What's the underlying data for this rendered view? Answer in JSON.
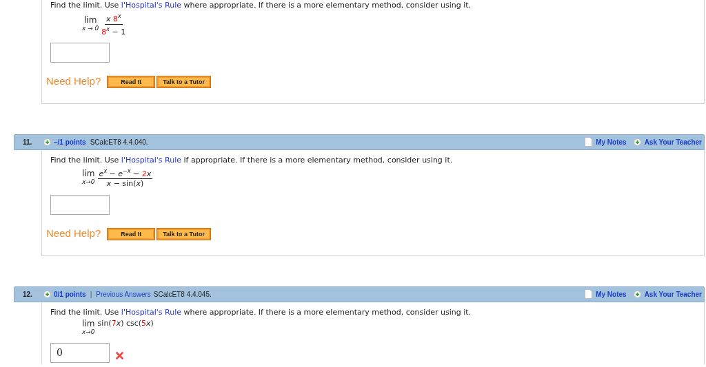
{
  "problems": [
    {
      "question": {
        "before": "Find the limit. Use ",
        "link": "l'Hospital's Rule",
        "after": " where appropriate. If there is a more elementary method, consider using it."
      },
      "expression": {
        "kind": "fraction",
        "lim": "lim",
        "under": "x → 0",
        "numerator": [
          {
            "text": "x",
            "kind": "variable",
            "raised": false,
            "highlight": false
          },
          {
            "text": " 8",
            "kind": "symbol",
            "raised": false,
            "highlight": true
          },
          {
            "text": "x",
            "kind": "variable",
            "raised": true,
            "highlight": false
          }
        ],
        "denominator": [
          {
            "text": "8",
            "kind": "symbol",
            "raised": false,
            "highlight": true
          },
          {
            "text": "x",
            "kind": "variable",
            "raised": true,
            "highlight": false
          },
          {
            "text": " − 1",
            "kind": "symbol",
            "raised": false,
            "highlight": false
          }
        ]
      },
      "answer": {
        "wrong": false
      },
      "help": {
        "label": "Need Help?",
        "buttons": [
          "Read It",
          "Talk to a Tutor"
        ]
      }
    },
    {
      "header": {
        "number": "11.",
        "points": "–/1 points",
        "source": "SCalcET8 4.4.040.",
        "notes": "My Notes",
        "ask": "Ask Your Teacher"
      },
      "question": {
        "before": "Find the limit. Use ",
        "link": "l'Hospital's Rule",
        "after": " if appropriate. If there is a more elementary method, consider using it."
      },
      "expression": {
        "kind": "fraction",
        "lim": "lim",
        "under": "x→0",
        "numerator": [
          {
            "text": "e",
            "kind": "variable",
            "raised": false,
            "highlight": false
          },
          {
            "text": "x",
            "kind": "variable",
            "raised": true,
            "highlight": false
          },
          {
            "text": " − ",
            "kind": "symbol",
            "raised": false,
            "highlight": false
          },
          {
            "text": "e",
            "kind": "variable",
            "raised": false,
            "highlight": false
          },
          {
            "text": "−",
            "kind": "symbol",
            "raised": true,
            "highlight": false
          },
          {
            "text": "x",
            "kind": "variable",
            "raised": true,
            "highlight": false
          },
          {
            "text": " − ",
            "kind": "symbol",
            "raised": false,
            "highlight": false
          },
          {
            "text": "2",
            "kind": "symbol",
            "raised": false,
            "highlight": true
          },
          {
            "text": "x",
            "kind": "variable",
            "raised": false,
            "highlight": false
          }
        ],
        "denominator": [
          {
            "text": "x",
            "kind": "variable",
            "raised": false,
            "highlight": false
          },
          {
            "text": " − sin(",
            "kind": "symbol",
            "raised": false,
            "highlight": false
          },
          {
            "text": "x",
            "kind": "variable",
            "raised": false,
            "highlight": false
          },
          {
            "text": ")",
            "kind": "symbol",
            "raised": false,
            "highlight": false
          }
        ]
      },
      "answer": {
        "wrong": false
      },
      "help": {
        "label": "Need Help?",
        "buttons": [
          "Read It",
          "Talk to a Tutor"
        ]
      }
    },
    {
      "header": {
        "number": "12.",
        "points": "0/1 points",
        "separator": "|",
        "previous": "Previous Answers",
        "source": "SCalcET8 4.4.045.",
        "notes": "My Notes",
        "ask": "Ask Your Teacher"
      },
      "question": {
        "before": "Find the limit. Use ",
        "link": "l'Hospital's Rule",
        "after": " where appropriate. If there is a more elementary method, consider using it."
      },
      "expression": {
        "kind": "inline",
        "lim": "lim",
        "under": "x→0",
        "body": [
          {
            "text": "sin(",
            "kind": "symbol",
            "raised": false,
            "highlight": false
          },
          {
            "text": "7",
            "kind": "symbol",
            "raised": false,
            "highlight": true
          },
          {
            "text": "x",
            "kind": "variable",
            "raised": false,
            "highlight": false
          },
          {
            "text": ") csc(",
            "kind": "symbol",
            "raised": false,
            "highlight": false
          },
          {
            "text": "5",
            "kind": "symbol",
            "raised": false,
            "highlight": true
          },
          {
            "text": "x",
            "kind": "variable",
            "raised": false,
            "highlight": false
          },
          {
            "text": ")",
            "kind": "symbol",
            "raised": false,
            "highlight": false
          }
        ]
      },
      "answer": {
        "value": "0",
        "wrong": true
      }
    }
  ]
}
